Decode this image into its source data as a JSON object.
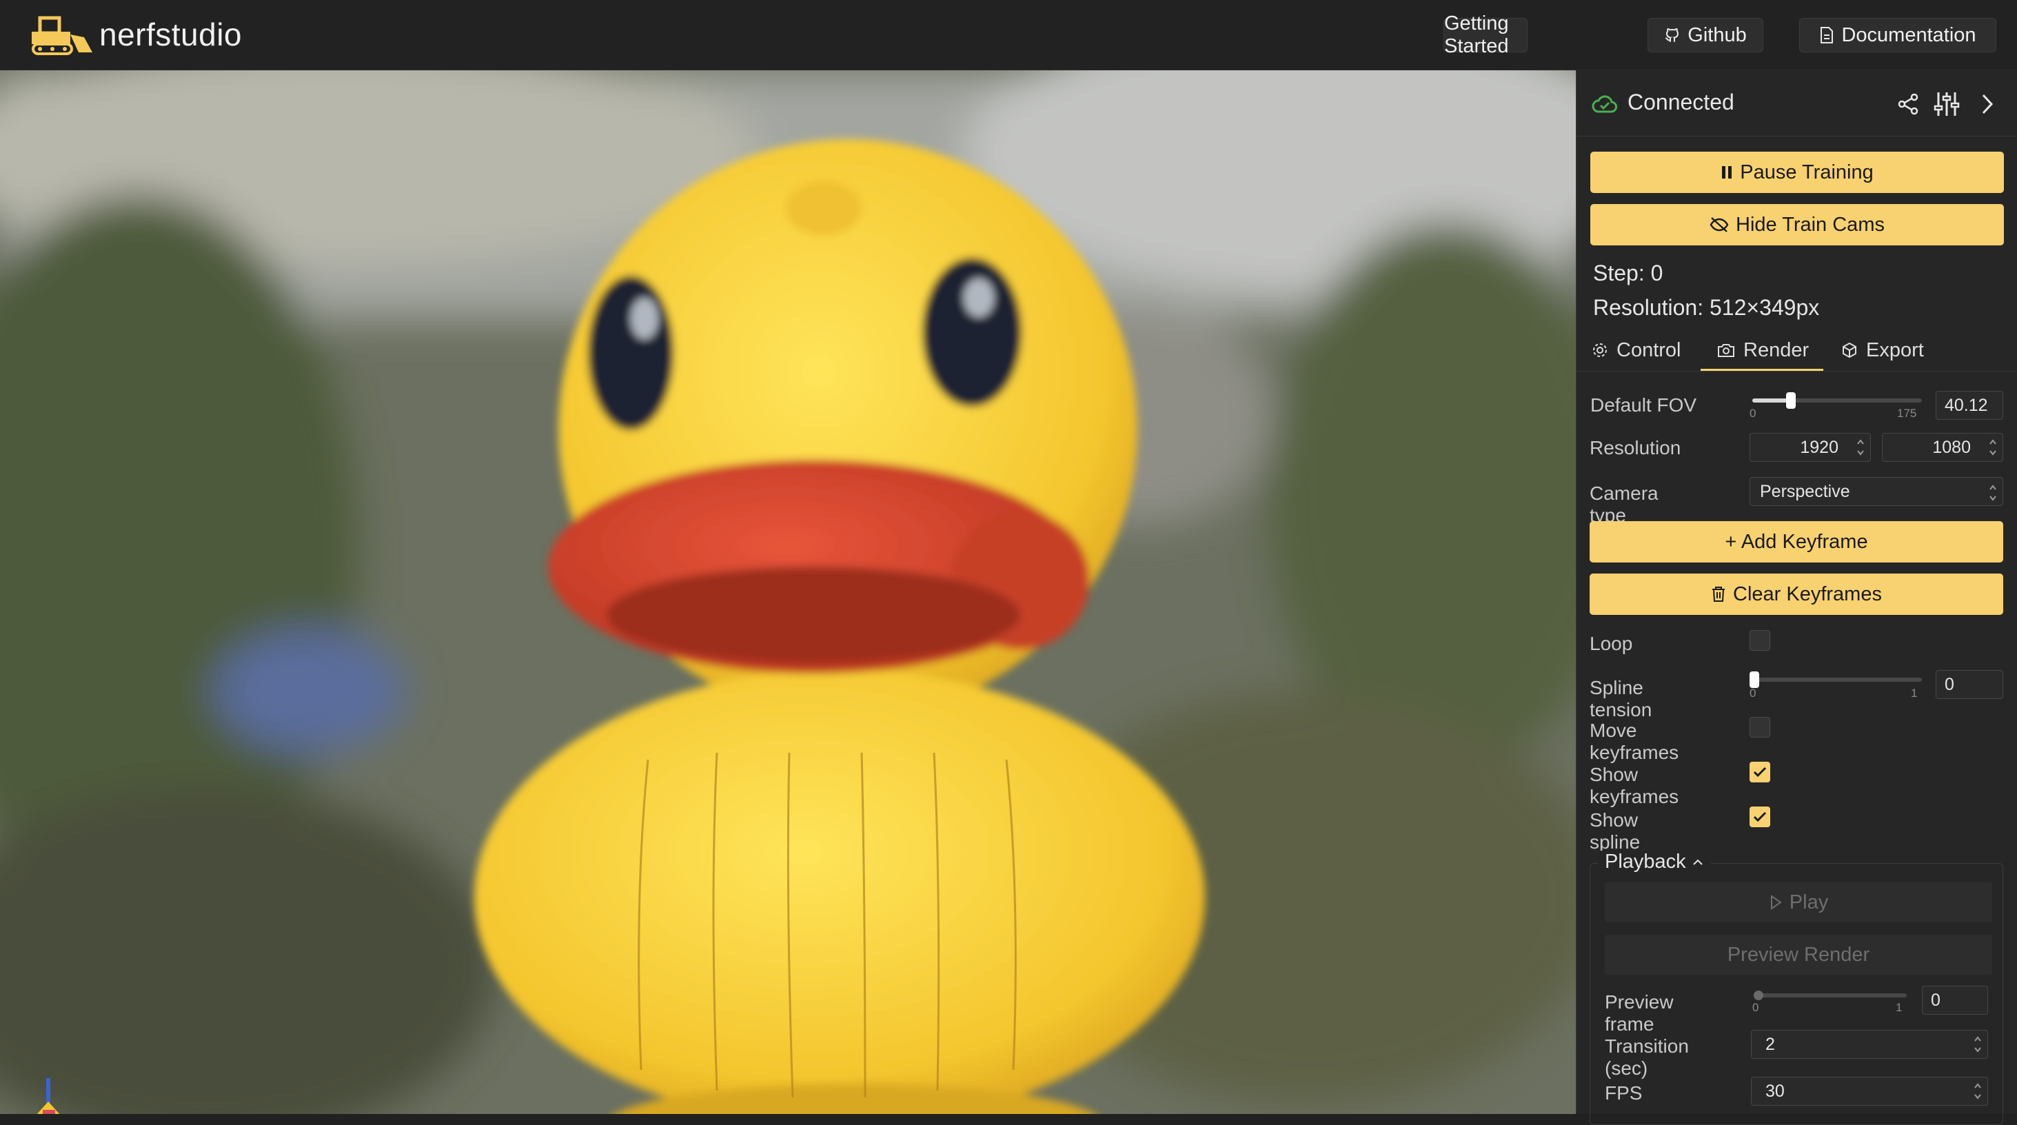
{
  "app": {
    "logo_text": "nerfstudio"
  },
  "nav": {
    "getting_started": "Getting Started",
    "github": "Github",
    "documentation": "Documentation"
  },
  "status": {
    "text": "Connected",
    "color": "#4caf50"
  },
  "buttons": {
    "pause_training": "Pause Training",
    "hide_train_cams": "Hide Train Cams",
    "add_keyframe": "+ Add Keyframe",
    "clear_keyframes": "Clear Keyframes"
  },
  "info": {
    "step": "Step: 0",
    "resolution": "Resolution: 512×349px"
  },
  "tabs": [
    {
      "label": "Control",
      "icon": "gear-icon"
    },
    {
      "label": "Render",
      "icon": "camera-icon",
      "active": true
    },
    {
      "label": "Export",
      "icon": "cube-icon"
    }
  ],
  "render": {
    "default_fov": {
      "label": "Default FOV",
      "min": "0",
      "max": "175",
      "value": "40.12",
      "fraction": 0.229
    },
    "resolution": {
      "label": "Resolution",
      "width": "1920",
      "height": "1080"
    },
    "camera_type": {
      "label": "Camera type",
      "value": "Perspective"
    },
    "loop": {
      "label": "Loop",
      "checked": false
    },
    "spline_tension": {
      "label": "Spline tension",
      "min": "0",
      "max": "1",
      "value": "0",
      "fraction": 0
    },
    "move_keyframes": {
      "label": "Move keyframes",
      "checked": false
    },
    "show_keyframes": {
      "label": "Show keyframes",
      "checked": true
    },
    "show_spline": {
      "label": "Show spline",
      "checked": true
    }
  },
  "playback": {
    "title": "Playback",
    "play": "Play",
    "preview_render": "Preview Render",
    "preview_frame": {
      "label": "Preview frame",
      "min": "0",
      "max": "1",
      "value": "0",
      "fraction": 0
    },
    "transition": {
      "label": "Transition (sec)",
      "value": "2"
    },
    "fps": {
      "label": "FPS",
      "value": "30"
    }
  },
  "colors": {
    "accent": "#f8d270",
    "panel": "#262626",
    "topbar": "#222222"
  }
}
